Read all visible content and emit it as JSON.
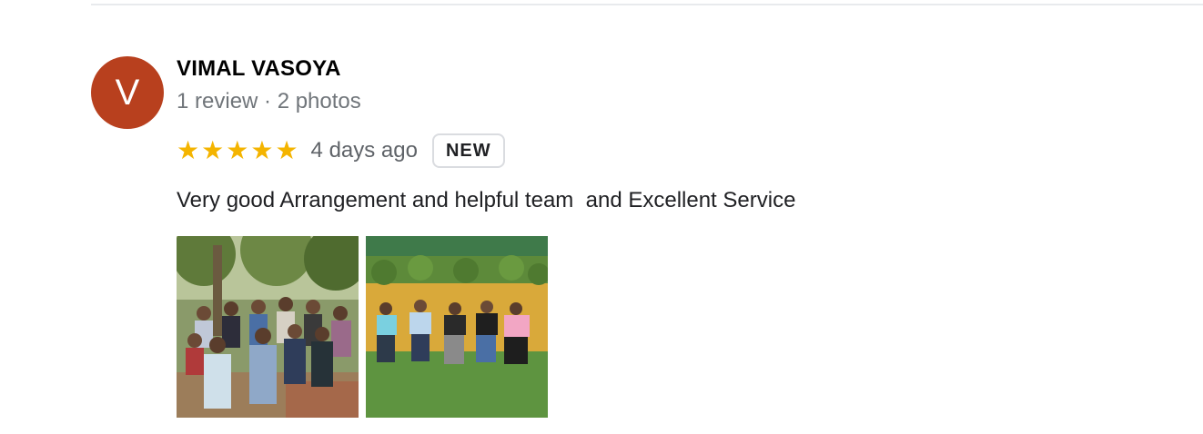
{
  "review": {
    "avatar_letter": "V",
    "avatar_color": "#b8401e",
    "author_name": "VIMAL VASOYA",
    "author_meta": "1 review · 2 photos",
    "rating": 5,
    "rating_max": 5,
    "star_color": "#f4b400",
    "time_ago": "4 days ago",
    "badge": "NEW",
    "text": "Very good Arrangement and helpful team  and Excellent Service",
    "photos": [
      {
        "name": "group-photo-garden-steps"
      },
      {
        "name": "group-photo-seated-lawn"
      }
    ]
  }
}
